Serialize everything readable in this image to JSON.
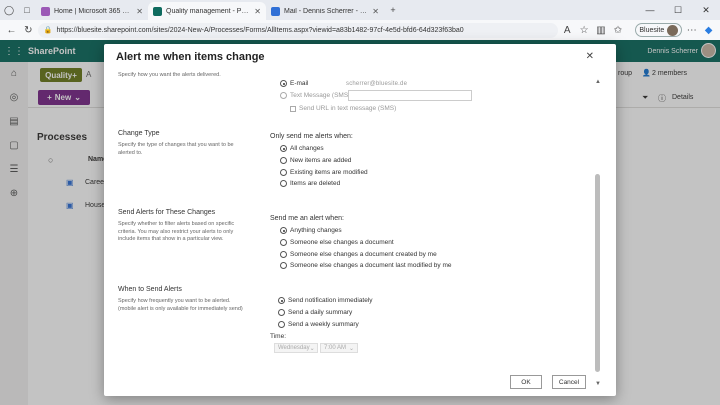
{
  "browser": {
    "tabs": [
      {
        "label": "Home | Microsoft 365 Copilot",
        "color": "#9b59b6"
      },
      {
        "label": "Quality management - Processes",
        "color": "#0f6b5f"
      },
      {
        "label": "Mail - Dennis Scherrer - Bluesite",
        "color": "#2f6fd6"
      }
    ],
    "new_tab": "+",
    "url": "https://bluesite.sharepoint.com/sites/2024-New-A/Processes/Forms/AllItems.aspx?viewid=a83b1482-97cf-4e5d-bfd6-64d323f63ba0",
    "profile_label": "Bluesite"
  },
  "sharepoint": {
    "app_name": "SharePoint",
    "user_name": "Dennis Scherrer",
    "site_logo": "Quality+",
    "new_button": "New",
    "library_title": "Processes",
    "col_name": "Name",
    "rows": [
      "Caree",
      "House"
    ],
    "group_text": "roup",
    "members": "2 members",
    "details": "Details",
    "nav_ic": "A"
  },
  "dialog": {
    "title": "Alert me when items change",
    "top_desc": "Specify how you want the alerts delivered.",
    "delivery": {
      "email_label": "E-mail",
      "email_value": "scherrer@bluesite.de",
      "sms_label": "Text Message (SMS)",
      "sms_url_label": "Send URL in text message (SMS)"
    },
    "change_type": {
      "title": "Change Type",
      "desc": "Specify the type of changes that you want to be alerted to.",
      "label": "Only send me alerts when:",
      "options": [
        "All changes",
        "New items are added",
        "Existing items are modified",
        "Items are deleted"
      ],
      "selected": 0
    },
    "filter": {
      "title": "Send Alerts for These Changes",
      "desc": "Specify whether to filter alerts based on specific criteria. You may also restrict your alerts to only include items that show in a particular view.",
      "label": "Send me an alert when:",
      "options": [
        "Anything changes",
        "Someone else changes a document",
        "Someone else changes a document created by me",
        "Someone else changes a document last modified by me"
      ],
      "selected": 0
    },
    "when": {
      "title": "When to Send Alerts",
      "desc": "Specify how frequently you want to be alerted. (mobile alert is only available for immediately send)",
      "options": [
        "Send notification immediately",
        "Send a daily summary",
        "Send a weekly summary"
      ],
      "selected": 0,
      "time_label": "Time:",
      "day_value": "Wednesday",
      "time_value": "7:00 AM"
    },
    "ok_label": "OK",
    "cancel_label": "Cancel"
  }
}
